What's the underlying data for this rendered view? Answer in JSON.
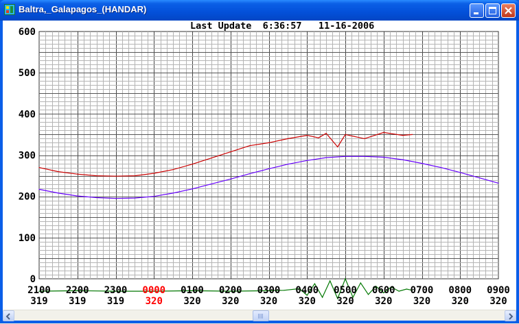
{
  "window": {
    "title": "Baltra,_Galapagos_(HANDAR)",
    "icon": "satellite-app-icon"
  },
  "controls": {
    "minimize_icon": "minimize-icon",
    "maximize_icon": "maximize-icon",
    "close_icon": "close-icon"
  },
  "header": {
    "text": "Last Update  6:36:57   11-16-2006"
  },
  "colors": {
    "red_series": "#cc0000",
    "purple_series": "#6600ff",
    "green_series": "#007700",
    "highlight_tick": "#ff0000"
  },
  "chart_data": {
    "type": "line",
    "title": "",
    "xlabel": "",
    "ylabel": "",
    "ylim": [
      0,
      600
    ],
    "y_ticks": [
      "0",
      "100",
      "200",
      "300",
      "400",
      "500",
      "600"
    ],
    "x_ticks": [
      "2100",
      "2200",
      "2300",
      "0000",
      "0100",
      "0200",
      "0300",
      "0400",
      "0500",
      "0600",
      "0700",
      "0800",
      "0900"
    ],
    "x_sub_ticks": [
      "319",
      "319",
      "319",
      "320",
      "320",
      "320",
      "320",
      "320",
      "320",
      "320",
      "320",
      "320",
      "320"
    ],
    "highlight_tick_index": 3,
    "grid": true,
    "series": [
      {
        "color": "#cc0000",
        "x_hours": [
          0,
          0.5,
          1,
          1.5,
          2,
          2.5,
          3,
          3.5,
          4,
          4.5,
          5,
          5.5,
          6,
          6.5,
          7,
          7.3,
          7.5,
          7.8,
          8.0,
          8.5,
          9.0,
          9.5,
          9.75
        ],
        "values": [
          270,
          260,
          254,
          250,
          249,
          250,
          256,
          265,
          278,
          293,
          308,
          323,
          330,
          340,
          348,
          342,
          353,
          320,
          350,
          340,
          355,
          348,
          350
        ]
      },
      {
        "color": "#6600ff",
        "x_hours": [
          0,
          0.5,
          1,
          1.5,
          2,
          2.5,
          3,
          3.5,
          4,
          4.5,
          5,
          5.5,
          6,
          6.5,
          7,
          7.5,
          8,
          8.5,
          9,
          9.5,
          10,
          10.5,
          11,
          11.5,
          12
        ],
        "values": [
          217,
          208,
          201,
          197,
          195,
          196,
          200,
          208,
          218,
          230,
          242,
          255,
          267,
          278,
          287,
          294,
          297,
          297,
          295,
          289,
          280,
          270,
          258,
          245,
          232
        ]
      },
      {
        "color": "#007700",
        "x_hours": [
          0,
          1,
          2,
          3,
          4,
          5,
          6,
          6.4,
          6.8,
          7.0,
          7.2,
          7.4,
          7.6,
          7.8,
          8.0,
          8.2,
          8.4,
          8.6,
          8.8,
          9.0,
          9.2,
          9.4,
          9.6,
          9.75
        ],
        "values": [
          -30,
          -29,
          -30,
          -30,
          -29,
          -30,
          -29,
          -28,
          -24,
          -40,
          -12,
          -45,
          -5,
          -48,
          0,
          -45,
          -10,
          -38,
          -18,
          -34,
          -20,
          -30,
          -25,
          -28
        ]
      }
    ]
  }
}
